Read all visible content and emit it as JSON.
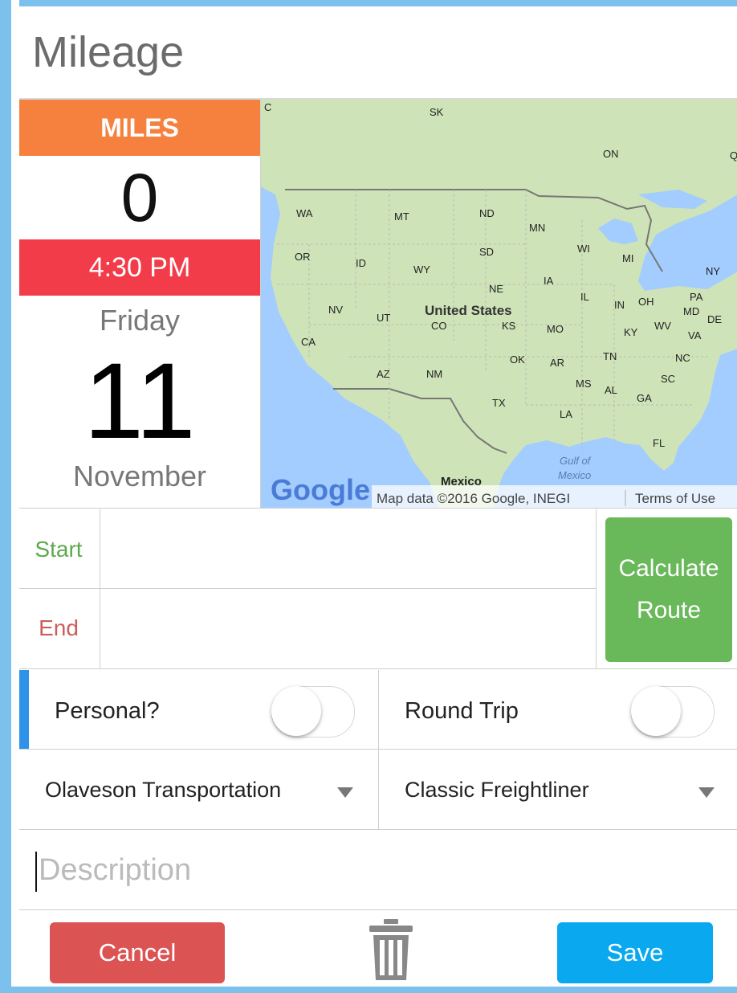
{
  "page": {
    "title": "Mileage"
  },
  "summary": {
    "miles_label": "MILES",
    "miles_value": "0",
    "time": "4:30 PM",
    "weekday": "Friday",
    "day": "11",
    "month": "November"
  },
  "map": {
    "labels": [
      "SK",
      "ON",
      "WA",
      "MT",
      "ND",
      "MN",
      "SD",
      "WI",
      "MI",
      "NY",
      "OR",
      "ID",
      "WY",
      "IA",
      "NE",
      "IL",
      "IN",
      "OH",
      "PA",
      "MD",
      "DE",
      "NV",
      "UT",
      "United States",
      "CO",
      "KS",
      "MO",
      "KY",
      "WV",
      "VA",
      "CA",
      "TN",
      "NC",
      "OK",
      "AR",
      "AZ",
      "NM",
      "MS",
      "AL",
      "SC",
      "GA",
      "TX",
      "LA",
      "FL",
      "Gulf of",
      "Mexico",
      "Mexico",
      "Q",
      "C"
    ],
    "logo": "Google",
    "attribution": "Map data ©2016 Google, INEGI",
    "terms": "Terms of Use",
    "colors": {
      "water": "#a3ccff",
      "land": "#cfe3b8"
    }
  },
  "route": {
    "start_label": "Start",
    "end_label": "End",
    "start_value": "",
    "end_value": "",
    "calculate_label": "Calculate\nRoute"
  },
  "options": {
    "personal_label": "Personal?",
    "personal_on": false,
    "round_trip_label": "Round Trip",
    "round_trip_on": false,
    "company_selected": "Olaveson Transportation",
    "vehicle_selected": "Classic Freightliner"
  },
  "description": {
    "placeholder": "Description",
    "value": ""
  },
  "actions": {
    "cancel_label": "Cancel",
    "delete_icon": "trash-icon",
    "save_label": "Save"
  },
  "colors": {
    "miles_header": "#f6813e",
    "time_bar": "#f33c4a",
    "calculate": "#69b85a",
    "cancel": "#dc5354",
    "save": "#0aa9ef",
    "accent_strip": "#2e93e8"
  }
}
